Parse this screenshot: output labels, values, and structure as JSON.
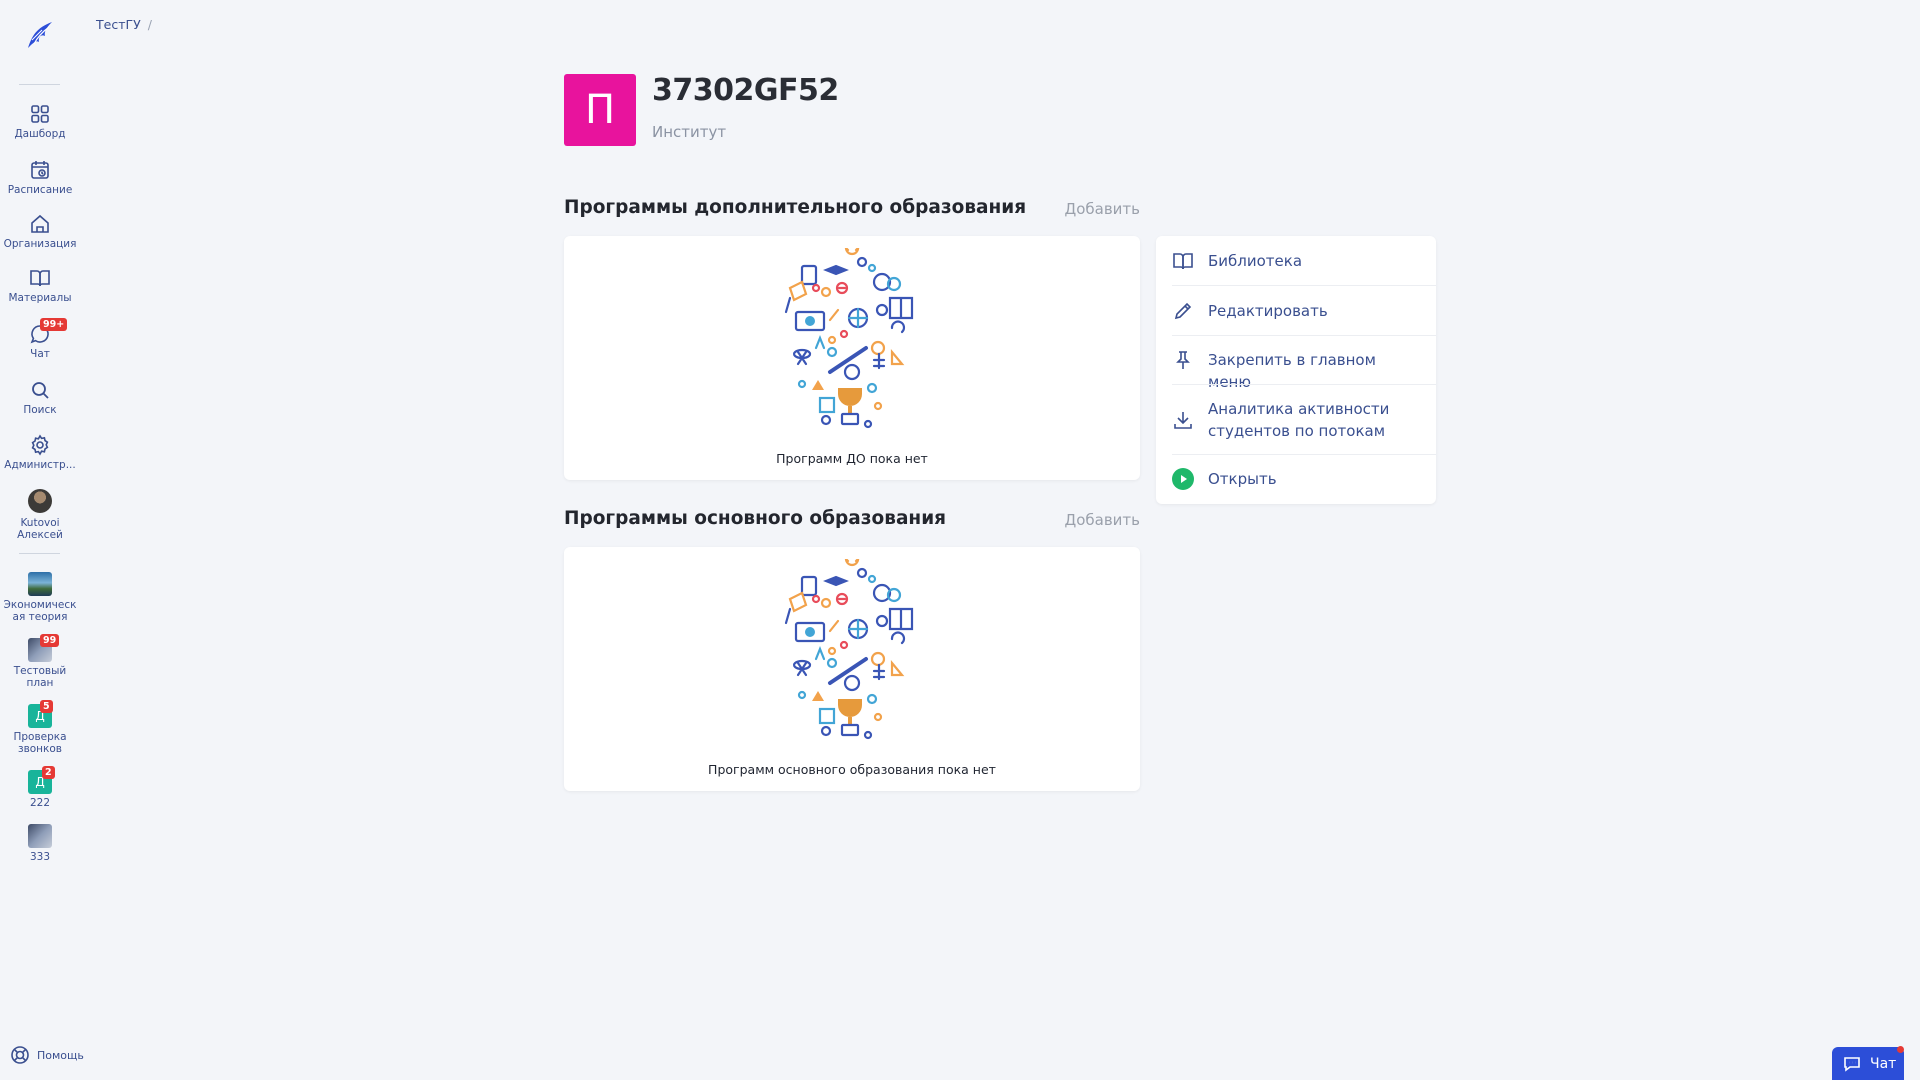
{
  "breadcrumb": {
    "root": "ТестГУ",
    "separator": "/"
  },
  "sidebar": {
    "nav": [
      {
        "label": "Дашборд",
        "icon": "dashboard-icon"
      },
      {
        "label": "Расписание",
        "icon": "schedule-icon"
      },
      {
        "label": "Организация",
        "icon": "organization-icon"
      },
      {
        "label": "Материалы",
        "icon": "materials-icon"
      },
      {
        "label": "Чат",
        "icon": "chat-icon",
        "badge": "99+"
      },
      {
        "label": "Поиск",
        "icon": "search-icon"
      },
      {
        "label": "Администр...",
        "icon": "gear-icon"
      }
    ],
    "user": {
      "label_line1": "Kutovoi",
      "label_line2": "Алексей"
    },
    "courses": [
      {
        "line1": "Экономическ",
        "line2": "ая теория",
        "badge": ""
      },
      {
        "line1": "Тестовый",
        "line2": "план",
        "badge": "99"
      },
      {
        "line1": "Проверка",
        "line2": "звонков",
        "badge": "5",
        "letter": "Д"
      },
      {
        "line1": "222",
        "line2": "",
        "badge": "2",
        "letter": "Д"
      },
      {
        "line1": "333",
        "line2": "",
        "badge": ""
      }
    ],
    "help_label": "Помощь"
  },
  "org": {
    "avatar_letter": "П",
    "title": "37302GF52",
    "subtitle": "Институт",
    "avatar_color": "#e8139d"
  },
  "sections": [
    {
      "title": "Программы дополнительного образования",
      "add_label": "Добавить",
      "empty_text": "Программ ДО пока нет"
    },
    {
      "title": "Программы основного образования",
      "add_label": "Добавить",
      "empty_text": "Программ основного образования пока нет"
    }
  ],
  "actions": [
    {
      "label": "Библиотека",
      "icon": "book-icon"
    },
    {
      "label": "Редактировать",
      "icon": "pencil-icon"
    },
    {
      "label": "Закрепить в главном меню",
      "icon": "pin-icon"
    },
    {
      "label": "Аналитика активности студентов по потокам",
      "icon": "download-icon"
    },
    {
      "label": "Открыть",
      "icon": "play-icon"
    }
  ],
  "chat_widget": {
    "label": "Чат"
  },
  "colors": {
    "accent": "#3a4f8f",
    "brand_blue": "#2c4ed8",
    "badge_red": "#e53935",
    "open_green": "#1fb86a"
  }
}
